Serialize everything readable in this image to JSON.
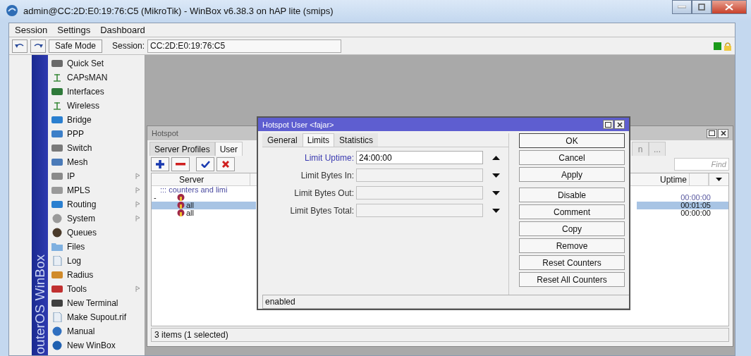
{
  "window": {
    "title": "admin@CC:2D:E0:19:76:C5 (MikroTik) - WinBox v6.38.3 on hAP lite (smips)"
  },
  "menu": [
    "Session",
    "Settings",
    "Dashboard"
  ],
  "toolbar": {
    "safe_mode": "Safe Mode",
    "session_label": "Session:",
    "session": "CC:2D:E0:19:76:C5"
  },
  "sidebar": {
    "brand": "outerOS WinBox",
    "items": [
      {
        "label": "Quick Set",
        "submenu": false
      },
      {
        "label": "CAPsMAN",
        "submenu": false
      },
      {
        "label": "Interfaces",
        "submenu": false
      },
      {
        "label": "Wireless",
        "submenu": false
      },
      {
        "label": "Bridge",
        "submenu": false
      },
      {
        "label": "PPP",
        "submenu": false
      },
      {
        "label": "Switch",
        "submenu": false
      },
      {
        "label": "Mesh",
        "submenu": false
      },
      {
        "label": "IP",
        "submenu": true
      },
      {
        "label": "MPLS",
        "submenu": true
      },
      {
        "label": "Routing",
        "submenu": true
      },
      {
        "label": "System",
        "submenu": true
      },
      {
        "label": "Queues",
        "submenu": false
      },
      {
        "label": "Files",
        "submenu": false
      },
      {
        "label": "Log",
        "submenu": false
      },
      {
        "label": "Radius",
        "submenu": false
      },
      {
        "label": "Tools",
        "submenu": true
      },
      {
        "label": "New Terminal",
        "submenu": false
      },
      {
        "label": "Make Supout.rif",
        "submenu": false
      },
      {
        "label": "Manual",
        "submenu": false
      },
      {
        "label": "New WinBox",
        "submenu": false
      }
    ]
  },
  "hotspot": {
    "title": "Hotspot",
    "tabs": [
      {
        "label": "Server Profiles",
        "selected": false
      },
      {
        "label": "User",
        "selected": true
      }
    ],
    "tabs_right": [
      "n",
      "..."
    ],
    "find": {
      "placeholder": "Find"
    },
    "columns": {
      "left": "Server",
      "right": "Uptime"
    },
    "comment": "::: counters and limi",
    "rows": [
      {
        "flag": "-",
        "uptime": "00:00:00",
        "selected": false
      },
      {
        "server": "all",
        "uptime": "00:01:05",
        "selected": true
      },
      {
        "server": "all",
        "uptime": "00:00:00",
        "selected": false
      }
    ],
    "status": "3 items (1 selected)"
  },
  "dialog": {
    "title": "Hotspot User <fajar>",
    "tabs": [
      {
        "label": "General",
        "selected": false
      },
      {
        "label": "Limits",
        "selected": true
      },
      {
        "label": "Statistics",
        "selected": false
      }
    ],
    "fields": [
      {
        "label": "Limit Uptime:",
        "value": "24:00:00",
        "modified": true,
        "kind": "collapse"
      },
      {
        "label": "Limit Bytes In:",
        "modified": false,
        "kind": "expand"
      },
      {
        "label": "Limit Bytes Out:",
        "modified": false,
        "kind": "expand"
      },
      {
        "label": "Limit Bytes Total:",
        "modified": false,
        "kind": "expand"
      }
    ],
    "buttons": [
      "OK",
      "Cancel",
      "Apply",
      "Disable",
      "Comment",
      "Copy",
      "Remove",
      "Reset Counters",
      "Reset All Counters"
    ],
    "status": "enabled"
  }
}
